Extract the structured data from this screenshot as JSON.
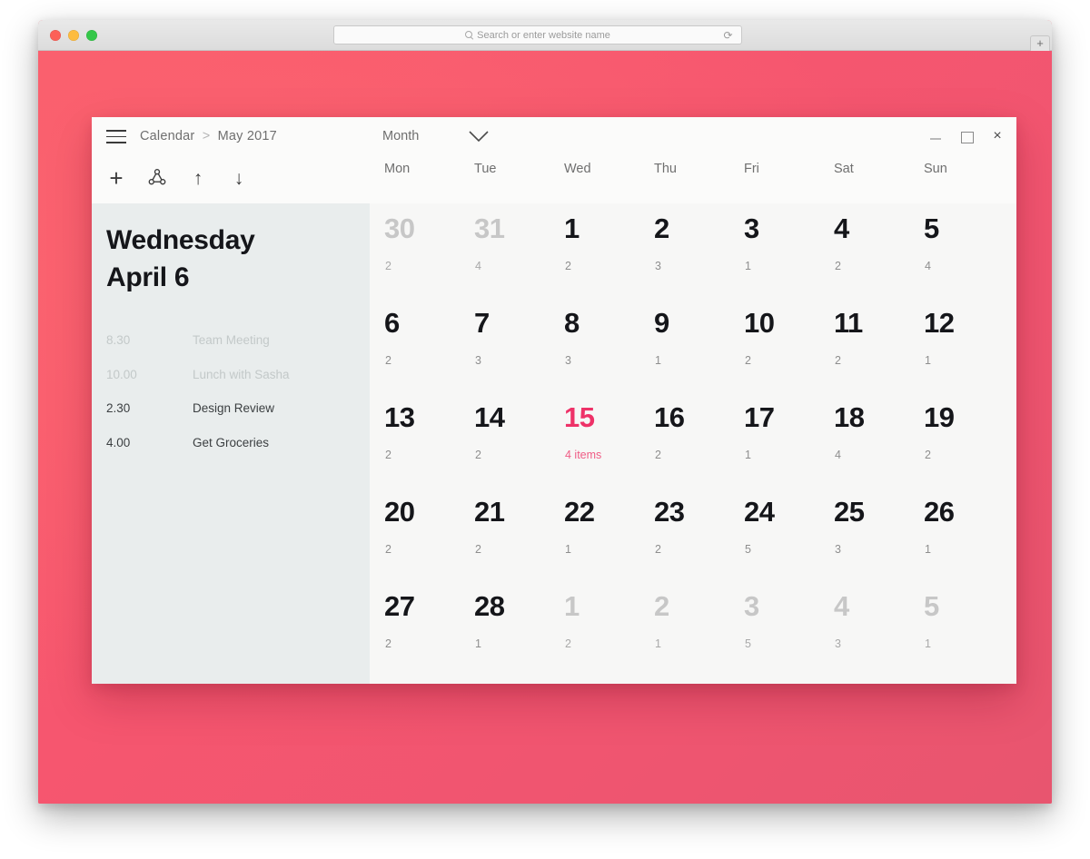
{
  "browser": {
    "address_placeholder": "Search or enter website name",
    "search_icon": "search-icon",
    "reload_icon": "reload-icon",
    "reload_glyph": "⟳",
    "new_tab_label": "+",
    "traffic_lights": [
      "close",
      "minimize",
      "maximize"
    ]
  },
  "app": {
    "breadcrumb": {
      "root": "Calendar",
      "separator": ">",
      "current": "May 2017"
    },
    "view_select": {
      "label": "Month",
      "chevron_icon": "chevron-down-icon"
    },
    "window_controls": {
      "minimize_icon": "minimize-icon",
      "maximize_icon": "maximize-icon",
      "close_icon": "close-icon",
      "close_glyph": "×"
    },
    "toolbar": {
      "add": {
        "icon": "plus-icon",
        "glyph": "+"
      },
      "share": {
        "icon": "share-icon"
      },
      "upload": {
        "icon": "arrow-up-icon",
        "glyph": "↑"
      },
      "download": {
        "icon": "arrow-down-icon",
        "glyph": "↓"
      }
    }
  },
  "sidebar": {
    "date_weekday": "Wednesday",
    "date_monthday": "April 6",
    "agenda": [
      {
        "time": "8.30",
        "title": "Team Meeting",
        "state": "past"
      },
      {
        "time": "10.00",
        "title": "Lunch with Sasha",
        "state": "past"
      },
      {
        "time": "2.30",
        "title": "Design Review",
        "state": "upcoming"
      },
      {
        "time": "4.00",
        "title": "Get Groceries",
        "state": "upcoming"
      }
    ]
  },
  "calendar": {
    "weekdays": [
      "Mon",
      "Tue",
      "Wed",
      "Thu",
      "Fri",
      "Sat",
      "Sun"
    ],
    "selected_day": 15,
    "accent_color": "#ee3268",
    "days": [
      {
        "n": "30",
        "meta": "2",
        "state": "other"
      },
      {
        "n": "31",
        "meta": "4",
        "state": "other"
      },
      {
        "n": "1",
        "meta": "2",
        "state": "current"
      },
      {
        "n": "2",
        "meta": "3",
        "state": "current"
      },
      {
        "n": "3",
        "meta": "1",
        "state": "current"
      },
      {
        "n": "4",
        "meta": "2",
        "state": "current"
      },
      {
        "n": "5",
        "meta": "4",
        "state": "current"
      },
      {
        "n": "6",
        "meta": "2",
        "state": "current"
      },
      {
        "n": "7",
        "meta": "3",
        "state": "current"
      },
      {
        "n": "8",
        "meta": "3",
        "state": "current"
      },
      {
        "n": "9",
        "meta": "1",
        "state": "current"
      },
      {
        "n": "10",
        "meta": "2",
        "state": "current"
      },
      {
        "n": "11",
        "meta": "2",
        "state": "current"
      },
      {
        "n": "12",
        "meta": "1",
        "state": "current"
      },
      {
        "n": "13",
        "meta": "2",
        "state": "current"
      },
      {
        "n": "14",
        "meta": "2",
        "state": "current"
      },
      {
        "n": "15",
        "meta": "4 items",
        "state": "selected"
      },
      {
        "n": "16",
        "meta": "2",
        "state": "current"
      },
      {
        "n": "17",
        "meta": "1",
        "state": "current"
      },
      {
        "n": "18",
        "meta": "4",
        "state": "current"
      },
      {
        "n": "19",
        "meta": "2",
        "state": "current"
      },
      {
        "n": "20",
        "meta": "2",
        "state": "current"
      },
      {
        "n": "21",
        "meta": "2",
        "state": "current"
      },
      {
        "n": "22",
        "meta": "1",
        "state": "current"
      },
      {
        "n": "23",
        "meta": "2",
        "state": "current"
      },
      {
        "n": "24",
        "meta": "5",
        "state": "current"
      },
      {
        "n": "25",
        "meta": "3",
        "state": "current"
      },
      {
        "n": "26",
        "meta": "1",
        "state": "current"
      },
      {
        "n": "27",
        "meta": "2",
        "state": "current"
      },
      {
        "n": "28",
        "meta": "1",
        "state": "current"
      },
      {
        "n": "1",
        "meta": "2",
        "state": "other"
      },
      {
        "n": "2",
        "meta": "1",
        "state": "other"
      },
      {
        "n": "3",
        "meta": "5",
        "state": "other"
      },
      {
        "n": "4",
        "meta": "3",
        "state": "other"
      },
      {
        "n": "5",
        "meta": "1",
        "state": "other"
      }
    ]
  }
}
